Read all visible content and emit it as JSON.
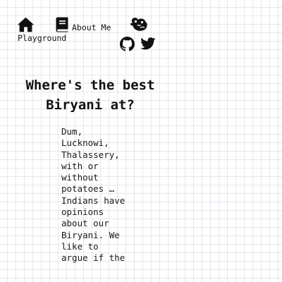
{
  "nav": {
    "home_icon": "home-icon",
    "book_icon": "book-icon",
    "about_label": "About Me",
    "playground_label": "Playground",
    "otter_icon": "otter-icon",
    "github_icon": "github-icon",
    "twitter_icon": "twitter-icon"
  },
  "article": {
    "title": "Where's the best Biryani at?",
    "body": "Dum, Lucknowi, Thalassery, with or without potatoes … Indians have opinions about our Biryani. We like to argue if the"
  },
  "colors": {
    "text": "#111111",
    "grid_line": "#e3e8ee",
    "background": "#ffffff"
  }
}
